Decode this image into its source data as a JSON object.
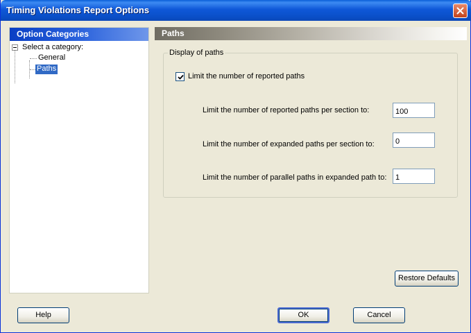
{
  "window": {
    "title": "Timing Violations Report Options"
  },
  "sidebar": {
    "header": "Option Categories",
    "root_label": "Select a category:",
    "items": [
      {
        "label": "General",
        "selected": false
      },
      {
        "label": "Paths",
        "selected": true
      }
    ]
  },
  "panel": {
    "header": "Paths",
    "group_title": "Display of paths",
    "limit_checkbox": {
      "label": "Limit the number of reported paths",
      "checked": true
    },
    "fields": [
      {
        "label": "Limit the number of reported paths per section to:",
        "value": "100"
      },
      {
        "label": "Limit the number of expanded paths per section to:",
        "value": "0"
      },
      {
        "label": "Limit the number of parallel paths in expanded path to:",
        "value": "1"
      }
    ],
    "restore_defaults_label": "Restore Defaults"
  },
  "footer": {
    "help_label": "Help",
    "ok_label": "OK",
    "cancel_label": "Cancel"
  },
  "colors": {
    "titlebar": "#0a4fc8",
    "selection": "#316ac5",
    "dialog_bg": "#ece9d8",
    "close_button": "#c2431d"
  },
  "icons": {
    "close": "close-icon",
    "expander": "tree-collapse-icon",
    "check": "checkmark-icon"
  }
}
